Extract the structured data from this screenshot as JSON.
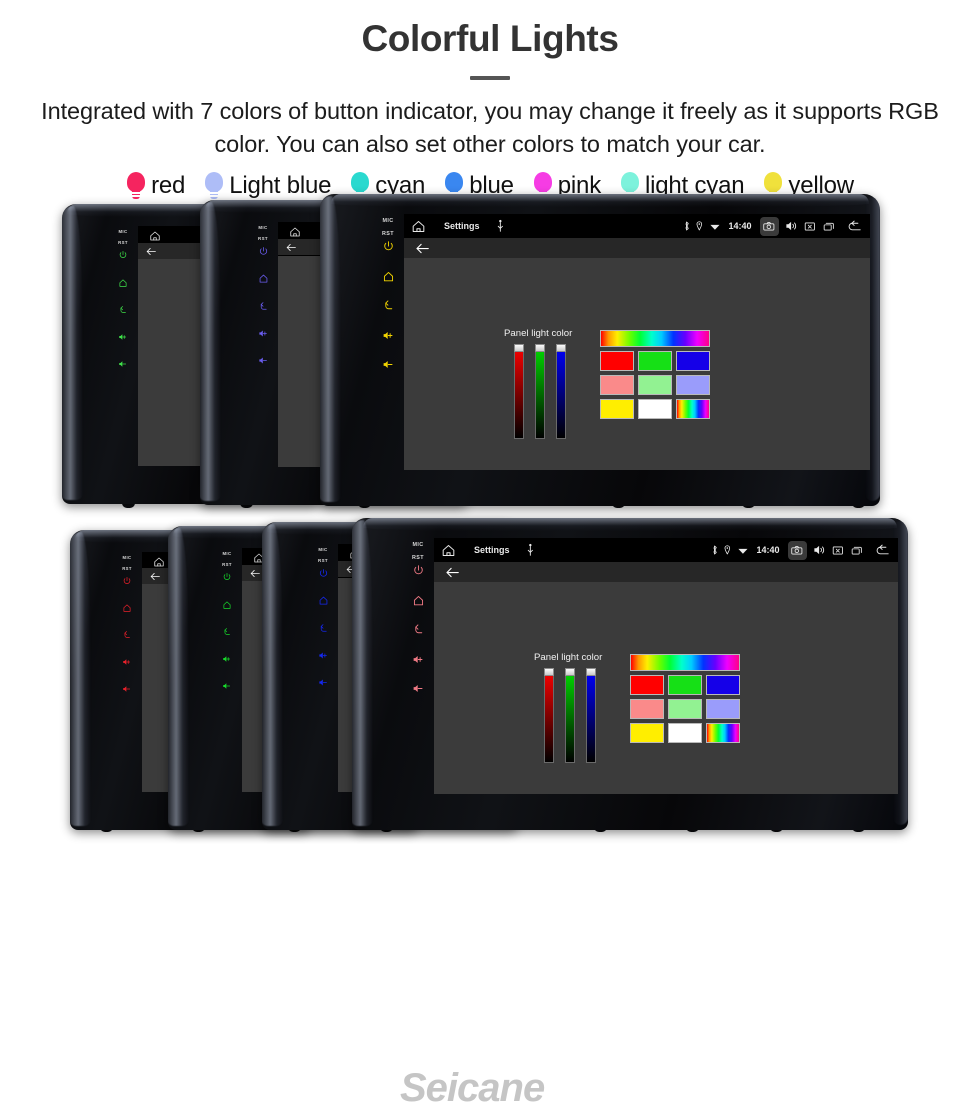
{
  "header": {
    "title": "Colorful Lights",
    "subtitle": "Integrated with 7 colors of button indicator, you may change it freely as it supports RGB color. You can also set other colors to match your car."
  },
  "legend": {
    "items": [
      {
        "label": "red",
        "color": "#f5245f"
      },
      {
        "label": "Light blue",
        "color": "#aebdf7"
      },
      {
        "label": "cyan",
        "color": "#2ad9cf"
      },
      {
        "label": "blue",
        "color": "#3a87f0"
      },
      {
        "label": "pink",
        "color": "#f63ce4"
      },
      {
        "label": "light cyan",
        "color": "#7df2dc"
      },
      {
        "label": "yellow",
        "color": "#f0e13c"
      }
    ]
  },
  "device": {
    "side_buttons": {
      "mic_label": "MIC",
      "rst_label": "RST",
      "icons": [
        "power-icon",
        "home-icon",
        "back-icon",
        "volume-up-icon",
        "volume-down-icon"
      ]
    },
    "statusbar": {
      "home_icon": "home-icon",
      "title": "Settings",
      "usb_icon": "usb-icon",
      "bluetooth_icon": "bluetooth-icon",
      "location_icon": "location-icon",
      "wifi_icon": "wifi-icon",
      "time": "14:40",
      "camera_icon": "camera-icon",
      "volume_icon": "volume-icon",
      "close_icon": "close-icon",
      "recents_icon": "recents-icon",
      "back_icon": "back-arrow-icon"
    },
    "appbar": {
      "back_icon": "back-arrow-icon"
    },
    "panel": {
      "label": "Panel light color",
      "sliders": [
        {
          "name": "red-slider",
          "color": "#ff0000",
          "value": 100
        },
        {
          "name": "green-slider",
          "color": "#00dd00",
          "value": 100
        },
        {
          "name": "blue-slider",
          "color": "#0000ff",
          "value": 100
        }
      ],
      "hue_bar": "hue-gradient",
      "swatches": [
        {
          "name": "swatch-red",
          "color": "#ff0000"
        },
        {
          "name": "swatch-green",
          "color": "#16e016"
        },
        {
          "name": "swatch-blue",
          "color": "#1500e8"
        },
        {
          "name": "swatch-salmon",
          "color": "#fa8a8a"
        },
        {
          "name": "swatch-lightgreen",
          "color": "#92f292"
        },
        {
          "name": "swatch-periwinkle",
          "color": "#9a9cfb"
        },
        {
          "name": "swatch-yellow",
          "color": "#ffee00"
        },
        {
          "name": "swatch-white",
          "color": "#ffffff"
        },
        {
          "name": "swatch-rainbow",
          "color": "rainbow"
        }
      ]
    }
  },
  "rows": [
    {
      "name": "top-row",
      "units": [
        {
          "name": "unit-green",
          "button_color": "#3fe04a",
          "screen": "blank"
        },
        {
          "name": "unit-purple",
          "button_color": "#6a5df0",
          "screen": "blank"
        },
        {
          "name": "unit-yellow",
          "button_color": "#f2d400",
          "screen": "full"
        }
      ]
    },
    {
      "name": "bottom-row",
      "units": [
        {
          "name": "unit-red",
          "button_color": "#e8202a",
          "screen": "blank"
        },
        {
          "name": "unit-green2",
          "button_color": "#17d82a",
          "screen": "blank"
        },
        {
          "name": "unit-blue",
          "button_color": "#1528f0",
          "screen": "blank"
        },
        {
          "name": "unit-pink",
          "button_color": "#f07a85",
          "screen": "full"
        }
      ]
    }
  ],
  "watermark": {
    "text": "Seicane"
  }
}
